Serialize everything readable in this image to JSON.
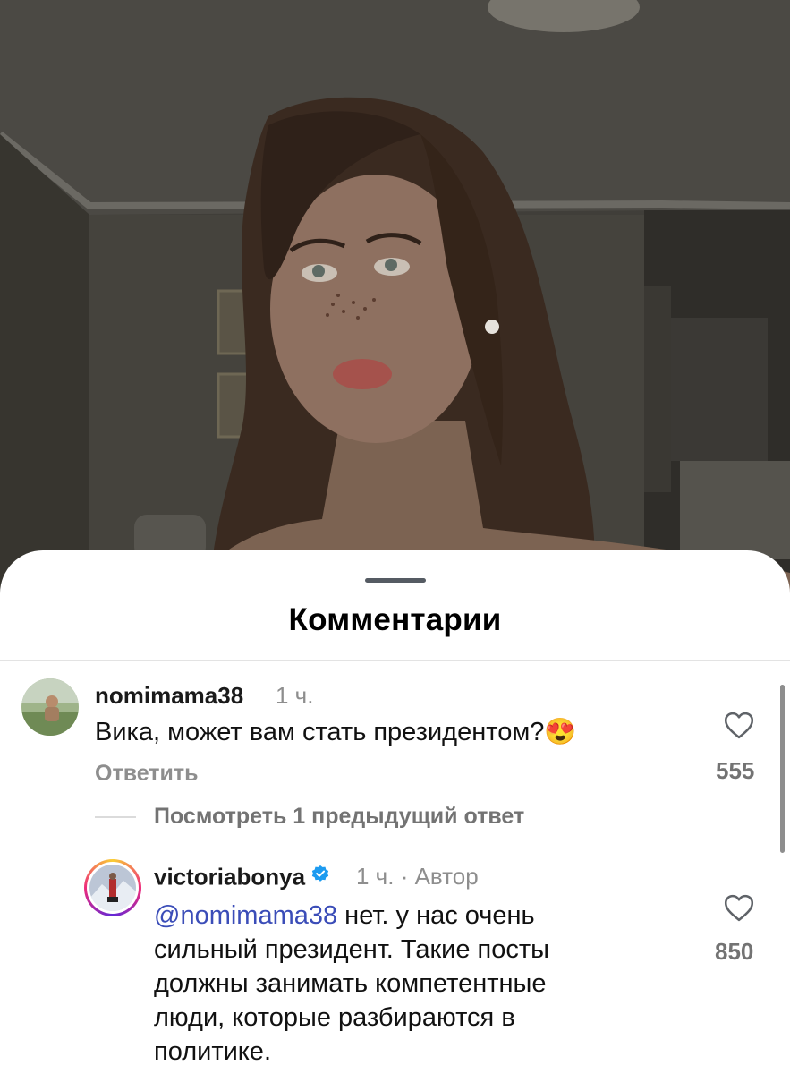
{
  "sheet": {
    "title": "Комментарии"
  },
  "comments": [
    {
      "username": "nomimama38",
      "time": "1 ч.",
      "text": "Вика, может вам стать президентом?",
      "emoji": "😍",
      "reply_label": "Ответить",
      "likes": "555",
      "view_replies": "Посмотреть 1 предыдущий ответ"
    }
  ],
  "reply": {
    "username": "victoriabonya",
    "verified": true,
    "time": "1 ч.",
    "separator": "·",
    "author_badge": "Автор",
    "mention": "@nomimama38",
    "text_line1": " нет. у нас очень",
    "text_line2": "сильный президент.  Такие посты",
    "text_line3": "должны занимать компетентные",
    "text_line4": "люди, которые разбираются в",
    "text_line5": "политике.",
    "likes": "850"
  },
  "colors": {
    "verified": "#1d9bf0",
    "mention": "#3b4db8",
    "muted": "#8e8e8e"
  },
  "icons": [
    "heart-icon",
    "verified-badge-icon"
  ]
}
